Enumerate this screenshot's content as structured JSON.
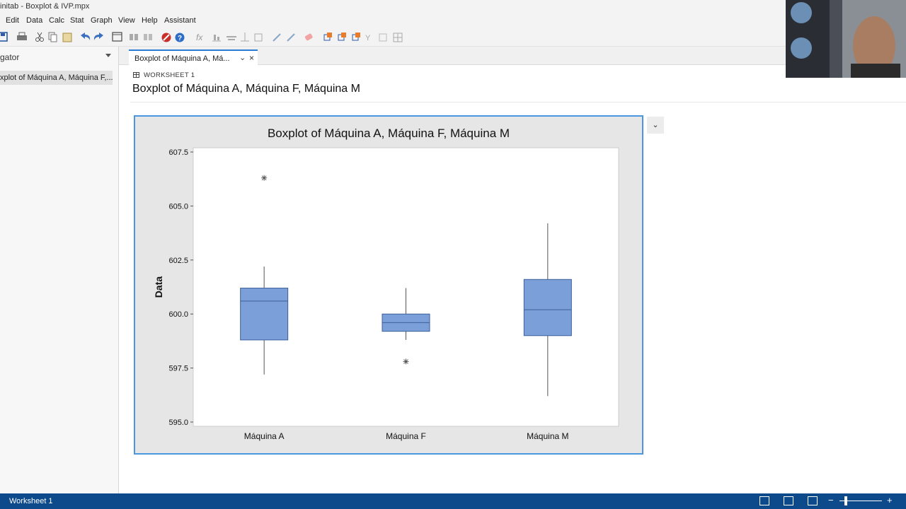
{
  "window": {
    "title": "initab - Boxplot & IVP.mpx"
  },
  "menu": [
    "Edit",
    "Data",
    "Calc",
    "Stat",
    "Graph",
    "View",
    "Help",
    "Assistant"
  ],
  "toolbar": {
    "icons": [
      "save-icon",
      "print-icon",
      "cut-icon",
      "copy-icon",
      "paste-icon",
      "undo-icon",
      "redo-icon",
      "new-window-icon",
      "find-icon",
      "replace-icon",
      "cancel-icon",
      "help-icon",
      "formula-icon",
      "dot-plot-icon",
      "bar-chart-icon",
      "scatter-icon",
      "brush-icon",
      "eraser-icon",
      "layout-icon",
      "duplicate-icon",
      "arrange-icon",
      "filter-icon",
      "grid-icon"
    ]
  },
  "navigator": {
    "title": "gator",
    "items": [
      "xplot of Máquina A, Máquina F,..."
    ]
  },
  "tabs": [
    {
      "label": "Boxplot of Máquina A, Má...",
      "chev": "⌄",
      "close": "×"
    }
  ],
  "output": {
    "worksheet_label": "WORKSHEET 1",
    "title": "Boxplot of Máquina A, Máquina F, Máquina M"
  },
  "statusbar": {
    "text": "Worksheet 1",
    "zoom_minus": "−",
    "zoom_plus": "+"
  },
  "colors": {
    "accent": "#4a97e0",
    "box_fill": "#7b9fd8",
    "box_stroke": "#3d5f9a",
    "statusbar": "#0c4a8c"
  },
  "chart_data": {
    "type": "boxplot",
    "title": "Boxplot of Máquina A, Máquina F, Máquina M",
    "xlabel": "",
    "ylabel": "Data",
    "ylim": [
      595.0,
      607.5
    ],
    "yticks": [
      "595.0",
      "597.5",
      "600.0",
      "602.5",
      "605.0",
      "607.5"
    ],
    "categories": [
      "Máquina A",
      "Máquina F",
      "Máquina M"
    ],
    "boxes": [
      {
        "name": "Máquina A",
        "whisker_low": 597.2,
        "q1": 598.8,
        "median": 600.6,
        "q3": 601.2,
        "whisker_high": 602.2,
        "outliers": [
          606.3
        ]
      },
      {
        "name": "Máquina F",
        "whisker_low": 598.8,
        "q1": 599.2,
        "median": 599.6,
        "q3": 600.0,
        "whisker_high": 601.2,
        "outliers": [
          597.8
        ]
      },
      {
        "name": "Máquina M",
        "whisker_low": 596.2,
        "q1": 599.0,
        "median": 600.2,
        "q3": 601.6,
        "whisker_high": 604.2,
        "outliers": []
      }
    ]
  }
}
